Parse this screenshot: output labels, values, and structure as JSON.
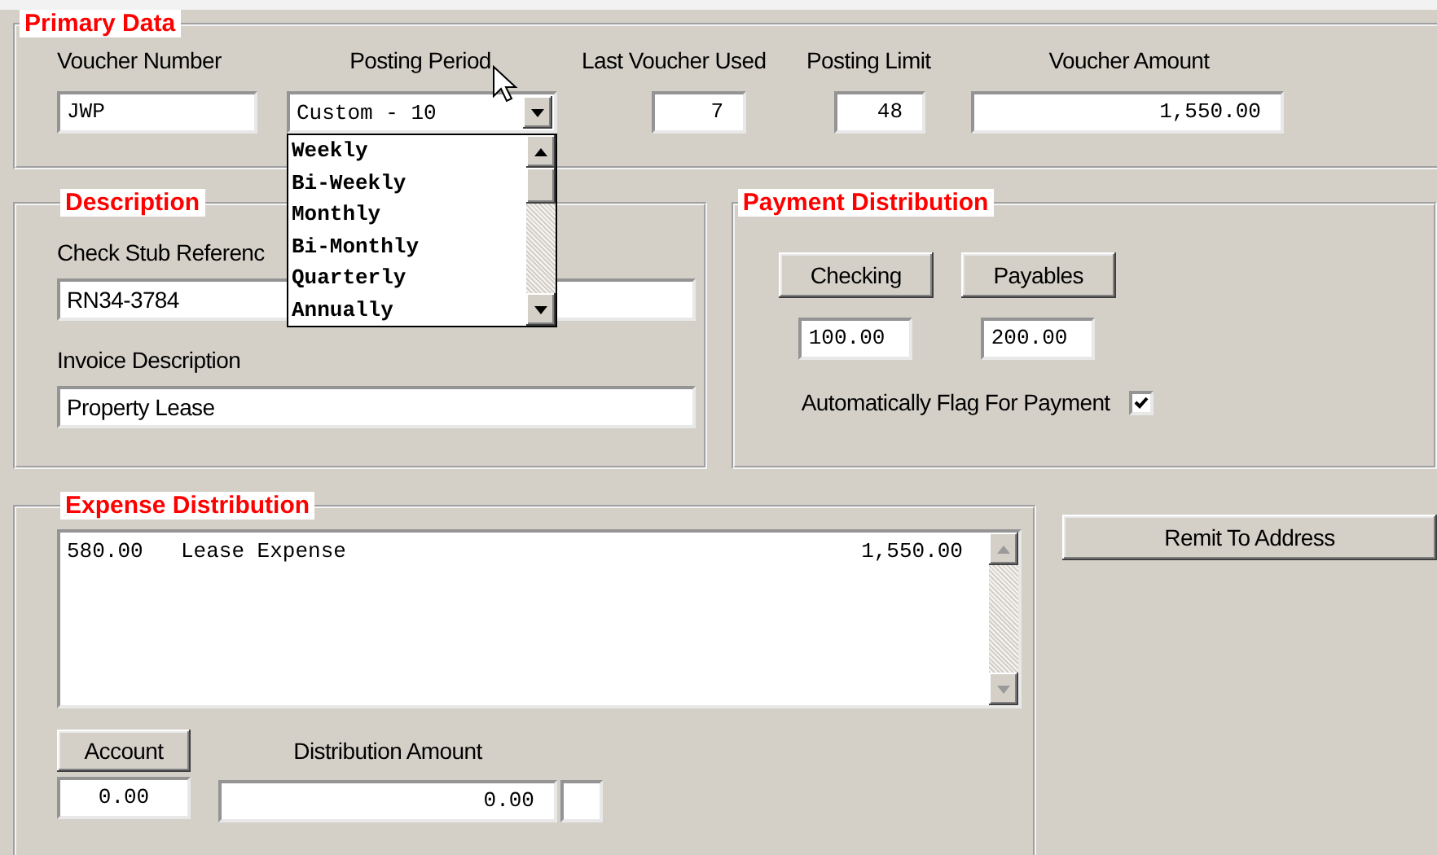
{
  "primary_data": {
    "title": "Primary Data",
    "voucher_number": {
      "label": "Voucher Number",
      "value": "JWP"
    },
    "posting_period": {
      "label": "Posting Period",
      "value": "Custom - 10",
      "expanded": true,
      "options": [
        {
          "label": "Weekly",
          "selected": false
        },
        {
          "label": "Bi-Weekly",
          "selected": false
        },
        {
          "label": "Monthly",
          "selected": false
        },
        {
          "label": "Bi-Monthly",
          "selected": false
        },
        {
          "label": "Quarterly",
          "selected": false
        },
        {
          "label": "Annually",
          "selected": false
        }
      ]
    },
    "last_voucher_used": {
      "label": "Last Voucher Used",
      "value": "7"
    },
    "posting_limit": {
      "label": "Posting Limit",
      "value": "48"
    },
    "voucher_amount": {
      "label": "Voucher Amount",
      "value": "1,550.00"
    }
  },
  "description": {
    "title": "Description",
    "check_stub_reference": {
      "label": "Check Stub Referenc",
      "value": "RN34-3784"
    },
    "invoice_description": {
      "label": "Invoice Description",
      "value": "Property Lease"
    }
  },
  "payment_distribution": {
    "title": "Payment Distribution",
    "accounts": [
      {
        "label": "Checking",
        "value": "100.00"
      },
      {
        "label": "Payables",
        "value": "200.00"
      }
    ],
    "auto_flag": {
      "label": "Automatically Flag For Payment",
      "checked": true
    }
  },
  "expense_distribution": {
    "title": "Expense Distribution",
    "rows": [
      {
        "account": "580.00",
        "description": "Lease Expense",
        "amount": "1,550.00"
      }
    ],
    "account_button": "Account",
    "account_value": "0.00",
    "distribution_amount": {
      "label": "Distribution Amount",
      "value": "0.00"
    }
  },
  "remit_button": "Remit To Address"
}
